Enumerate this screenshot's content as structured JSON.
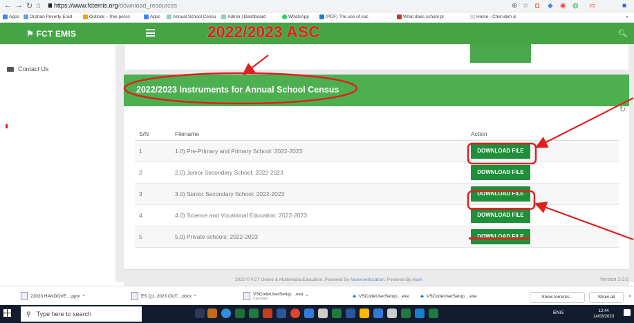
{
  "browser": {
    "url_host": "https://www.fctemis.org",
    "url_path": "/download_resources",
    "bookmarks": [
      "Apps",
      "Orphan Poverty Erad",
      "Outlook – free perso",
      "Apps",
      "Annual School Censu",
      "Admin | Dashboard",
      "WhatsApp",
      "(PDF) The use of soc",
      "What does school pr",
      "Home - Cherubim &"
    ],
    "right_chevron": "»"
  },
  "header": {
    "logo_text": "FCT EMIS",
    "annotation": "2022/2023 ASC"
  },
  "sidebar": {
    "contact_label": "Contact Us"
  },
  "section": {
    "title": "2022/2023 Instruments for Annual School Census"
  },
  "table": {
    "headers": [
      "S/N",
      "Filename",
      "Action"
    ],
    "rows": [
      {
        "sn": "1",
        "filename": "1.0) Pre-Primary and Primary School: 2022-2023",
        "action": "DOWNLOAD FILE"
      },
      {
        "sn": "2",
        "filename": "2.0) Junior Secondary School: 2022-2023",
        "action": "DOWNLOAD FILE"
      },
      {
        "sn": "3",
        "filename": "3.0) Senior Secondary School: 2022-2023",
        "action": "DOWNLOAD FILE"
      },
      {
        "sn": "4",
        "filename": "4.0) Science and Vocational Education: 2022-2023",
        "action": "DOWNLOAD FILE"
      },
      {
        "sn": "5",
        "filename": "5.0) Private schools: 2022-2023",
        "action": "DOWNLOAD FILE"
      }
    ]
  },
  "footer": {
    "text_a": "2022 © FCT Online & Multimedia Education. Powered By ",
    "link_a": "Alamexeducation",
    "text_b": ". Powered By ",
    "link_b": "Alam",
    "version": "Version 2.0.0"
  },
  "downloads": {
    "items": [
      {
        "name": "22023 HANDOVE....pptx",
        "sub": ""
      },
      {
        "name": "ES Q1, 2023 OUT....docx",
        "sub": ""
      },
      {
        "name": "VSCodeUserSetup....exe",
        "sub": "Canceled"
      },
      {
        "name": "VSCodeUserSetup....exe",
        "sub": ""
      },
      {
        "name": "VSCodeUserSetup....exe",
        "sub": ""
      }
    ],
    "show_torrents": "Show torrents...",
    "show_all": "Show all",
    "close": "×"
  },
  "taskbar": {
    "search_placeholder": "Type here to search",
    "time": "12:44",
    "date": "14/03/2023",
    "lang": "ENG"
  }
}
